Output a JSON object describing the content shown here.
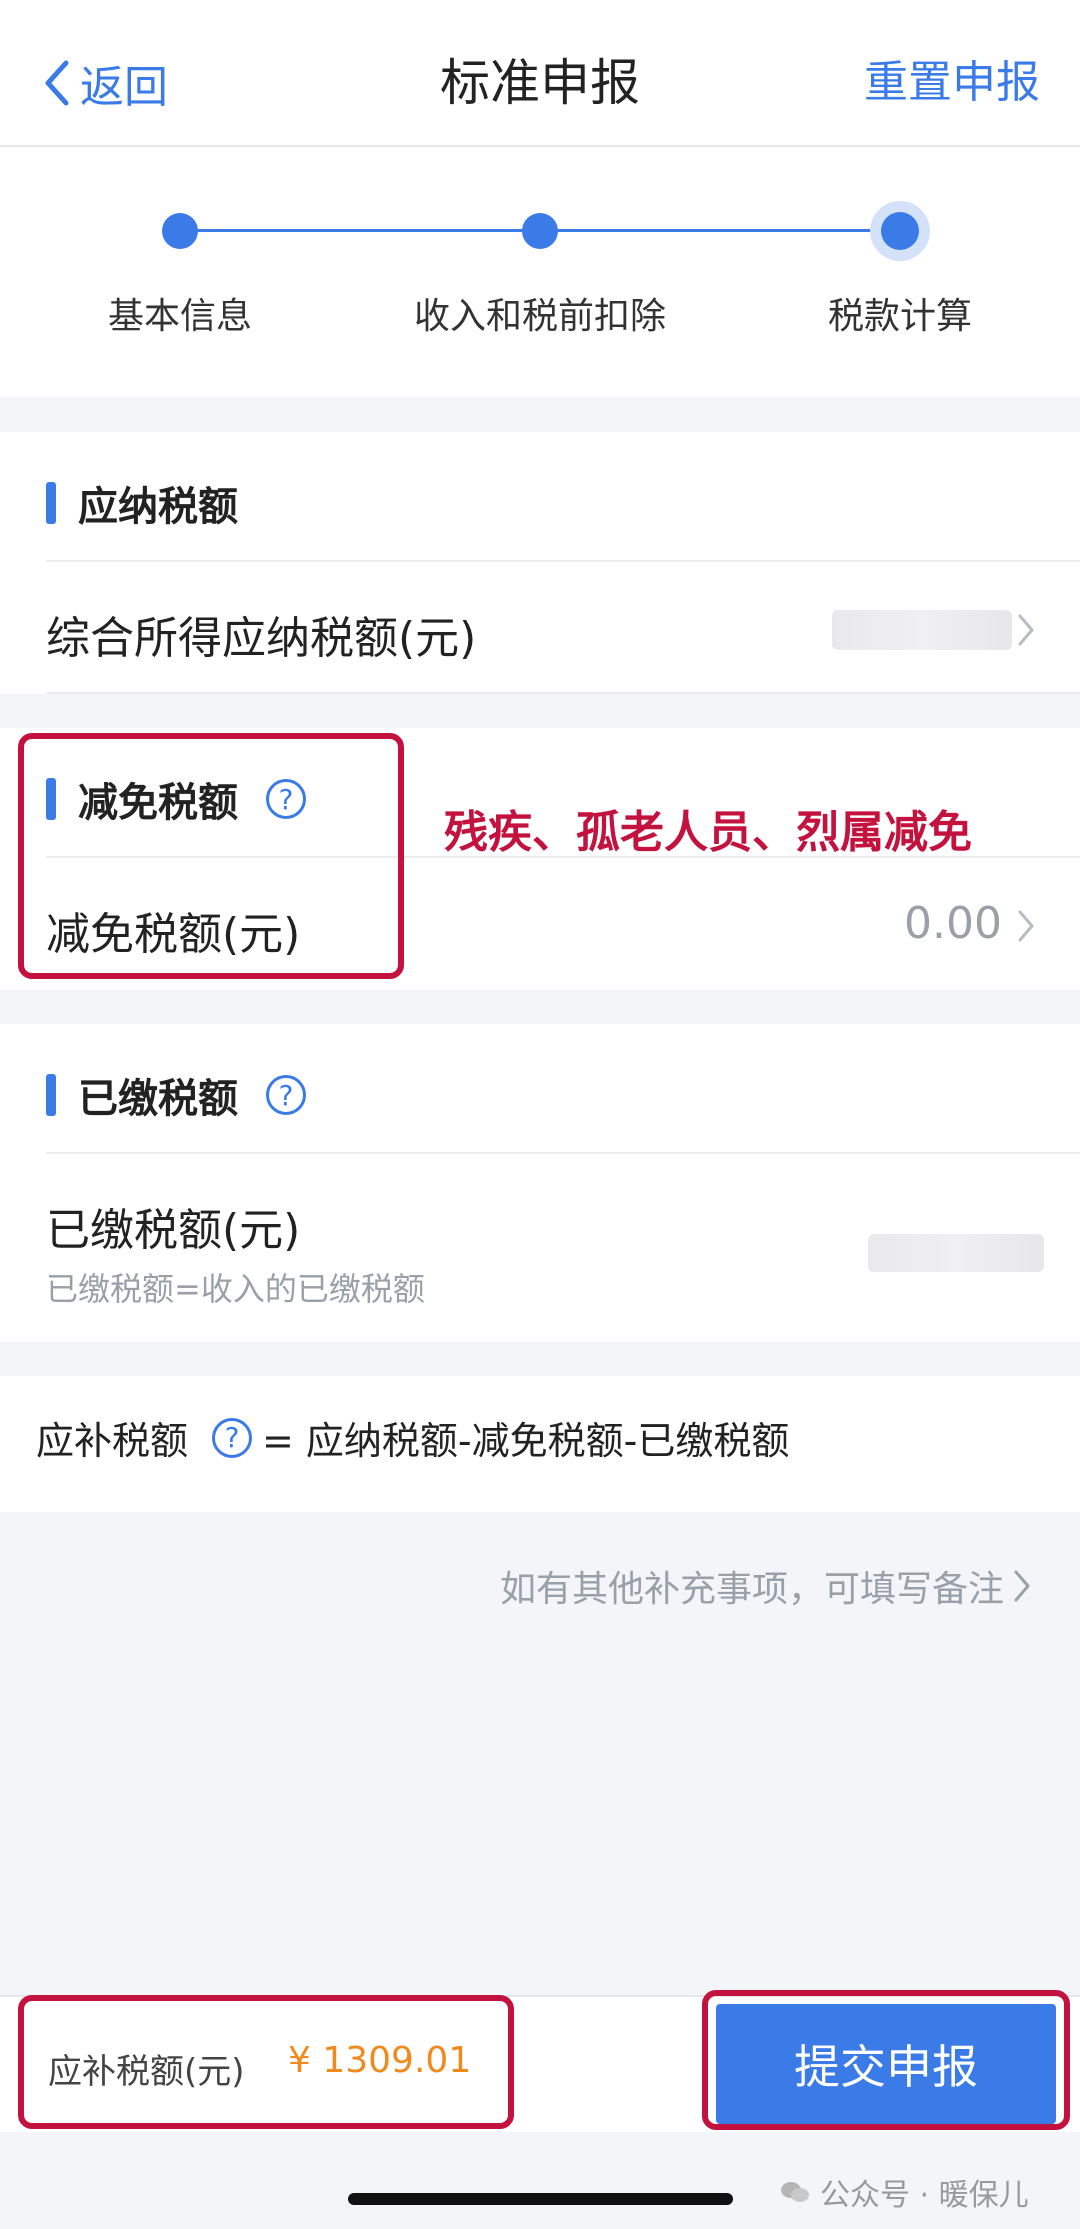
{
  "header": {
    "back_label": "返回",
    "title": "标准申报",
    "reset_label": "重置申报"
  },
  "steps": [
    {
      "label": "基本信息",
      "state": "done"
    },
    {
      "label": "收入和税前扣除",
      "state": "done"
    },
    {
      "label": "税款计算",
      "state": "active"
    }
  ],
  "section_payable": {
    "title": "应纳税额",
    "row_label": "综合所得应纳税额(元)"
  },
  "section_reduction": {
    "title": "减免税额",
    "row_label": "减免税额(元)",
    "row_value": "0.00"
  },
  "section_paid": {
    "title": "已缴税额",
    "row_label": "已缴税额(元)",
    "row_sub": "已缴税额=收入的已缴税额"
  },
  "formula": {
    "label": "应补税额",
    "expression": "= 应纳税额-减免税额-已缴税额"
  },
  "remark": {
    "text": "如有其他补充事项，可填写备注"
  },
  "annotation": {
    "text": "残疾、孤老人员、烈属减免"
  },
  "bottom": {
    "due_label": "应补税额(元)",
    "due_value": "¥ 1309.01",
    "submit_label": "提交申报"
  },
  "watermark": {
    "text": "公众号 · 暖保儿"
  },
  "colors": {
    "accent": "#3a7be8",
    "annotation": "#c4123f",
    "amount": "#f08a1c"
  }
}
